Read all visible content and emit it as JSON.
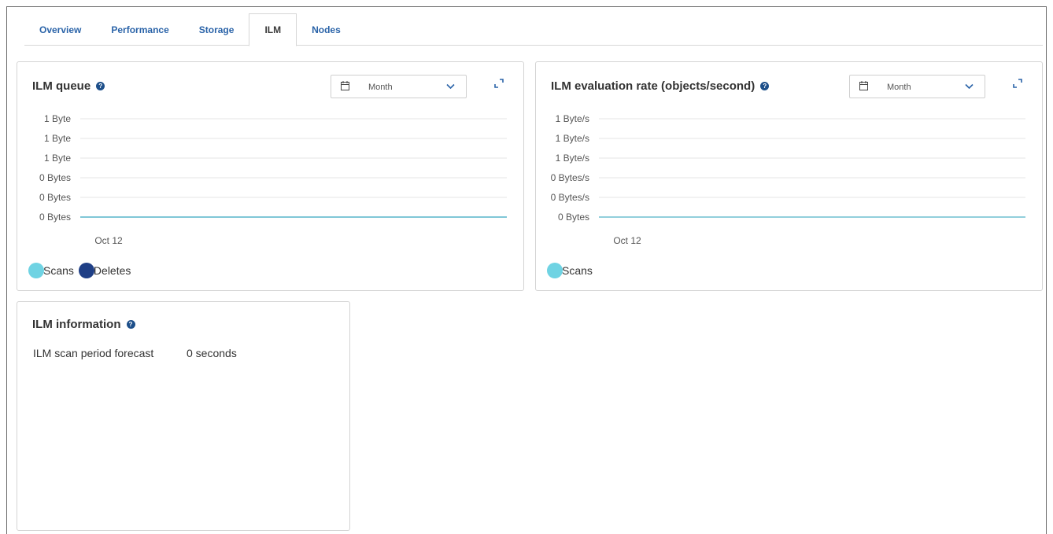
{
  "tabs": [
    {
      "label": "Overview",
      "active": false
    },
    {
      "label": "Performance",
      "active": false
    },
    {
      "label": "Storage",
      "active": false
    },
    {
      "label": "ILM",
      "active": true
    },
    {
      "label": "Nodes",
      "active": false
    }
  ],
  "queue_card": {
    "title": "ILM queue",
    "period_select": "Month",
    "icons": {
      "help": "question-circle-icon",
      "calendar": "calendar-icon",
      "chevron": "chevron-down-icon",
      "expand": "expand-icon"
    }
  },
  "eval_card": {
    "title": "ILM evaluation rate (objects/second)",
    "period_select": "Month",
    "icons": {
      "help": "question-circle-icon",
      "calendar": "calendar-icon",
      "chevron": "chevron-down-icon",
      "expand": "expand-icon"
    }
  },
  "info_card": {
    "title": "ILM information",
    "rows": [
      {
        "label": "ILM scan period forecast",
        "value": "0 seconds"
      }
    ]
  },
  "colors": {
    "accent_tab": "#2a63a8",
    "scans": "#6fd3e3",
    "deletes": "#1f3f86",
    "line": "#6fbfd1",
    "help": "#1d4f8a"
  },
  "chart_data": [
    {
      "type": "line",
      "title": "ILM queue",
      "y_tick_labels": [
        "1 Byte",
        "1 Byte",
        "1 Byte",
        "0 Bytes",
        "0 Bytes",
        "0 Bytes"
      ],
      "x_tick_labels": [
        "Oct 12"
      ],
      "grid": true,
      "legend": "bottom-left",
      "series": [
        {
          "name": "Scans",
          "color": "#6fd3e3",
          "values": [
            0,
            0
          ]
        },
        {
          "name": "Deletes",
          "color": "#1f3f86",
          "values": [
            0,
            0
          ]
        }
      ]
    },
    {
      "type": "line",
      "title": "ILM evaluation rate (objects/second)",
      "y_tick_labels": [
        "1 Byte/s",
        "1 Byte/s",
        "1 Byte/s",
        "0 Bytes/s",
        "0 Bytes/s",
        "0 Bytes"
      ],
      "x_tick_labels": [
        "Oct 12"
      ],
      "grid": true,
      "legend": "bottom-left",
      "series": [
        {
          "name": "Scans",
          "color": "#6fd3e3",
          "values": [
            0,
            0
          ]
        }
      ]
    }
  ]
}
